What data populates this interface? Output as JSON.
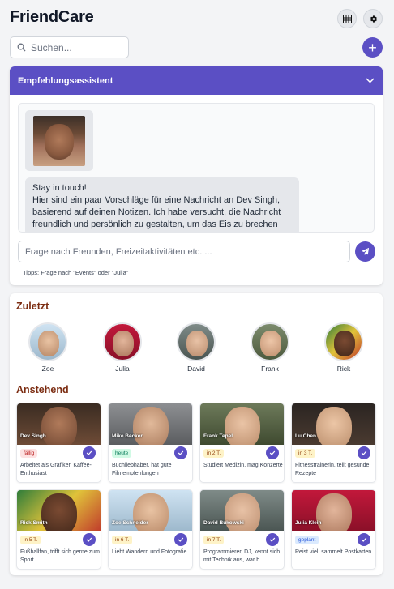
{
  "header": {
    "title": "FriendCare"
  },
  "search": {
    "placeholder": "Suchen..."
  },
  "add_button": {
    "label": "+"
  },
  "assistant": {
    "title": "Empfehlungsassistent",
    "message_lines": [
      "Stay in touch!",
      "Hier sind ein paar Vorschläge für eine Nachricht an Dev Singh,",
      "basierend auf deinen Notizen. Ich habe versucht, die Nachricht",
      "freundlich und persönlich zu gestalten, um das Eis zu brechen"
    ],
    "input_placeholder": "Frage nach Freunden, Freizeitaktivitäten etc. ...",
    "tips": "Tipps: Frage nach \"Events\" oder \"Julia\""
  },
  "recent": {
    "title": "Zuletzt",
    "items": [
      {
        "name": "Zoe"
      },
      {
        "name": "Julia"
      },
      {
        "name": "David"
      },
      {
        "name": "Frank"
      },
      {
        "name": "Rick"
      }
    ]
  },
  "upcoming": {
    "title": "Anstehend",
    "cards": [
      {
        "name": "Dev Singh",
        "badge": "fällig",
        "desc": "Arbeitet als Grafiker, Kaffee-Enthusiast"
      },
      {
        "name": "Mike Becker",
        "badge": "heute",
        "desc": "Buchliebhaber, hat gute Filmempfehlungen"
      },
      {
        "name": "Frank Tepel",
        "badge": "in 2 T.",
        "desc": "Studiert Medizin, mag Konzerte"
      },
      {
        "name": "Lu Chen",
        "badge": "in 3 T.",
        "desc": "Fitnesstrainerin, teilt gesunde Rezepte"
      },
      {
        "name": "Rick Smith",
        "badge": "in 5 T.",
        "desc": "Fußballfan, trifft sich gerne zum Sport"
      },
      {
        "name": "Zoe Schneider",
        "badge": "in 6 T.",
        "desc": "Liebt Wandern und Fotografie"
      },
      {
        "name": "David Bukowski",
        "badge": "in 7 T.",
        "desc": "Programmierer, DJ, kennt sich mit Technik aus, war b..."
      },
      {
        "name": "Julia Klein",
        "badge": "geplant",
        "desc": "Reist viel, sammelt Postkarten"
      }
    ]
  },
  "colors": {
    "accent": "#5b4fc4",
    "badge_overdue_bg": "#fde2e2",
    "badge_overdue_fg": "#b91c1c",
    "badge_today_bg": "#d1fae5",
    "badge_today_fg": "#047857",
    "badge_soon_bg": "#fef3c7",
    "badge_soon_fg": "#92400e",
    "badge_planned_bg": "#dbeafe",
    "badge_planned_fg": "#1d4ed8",
    "section_title": "#7c2d12"
  }
}
